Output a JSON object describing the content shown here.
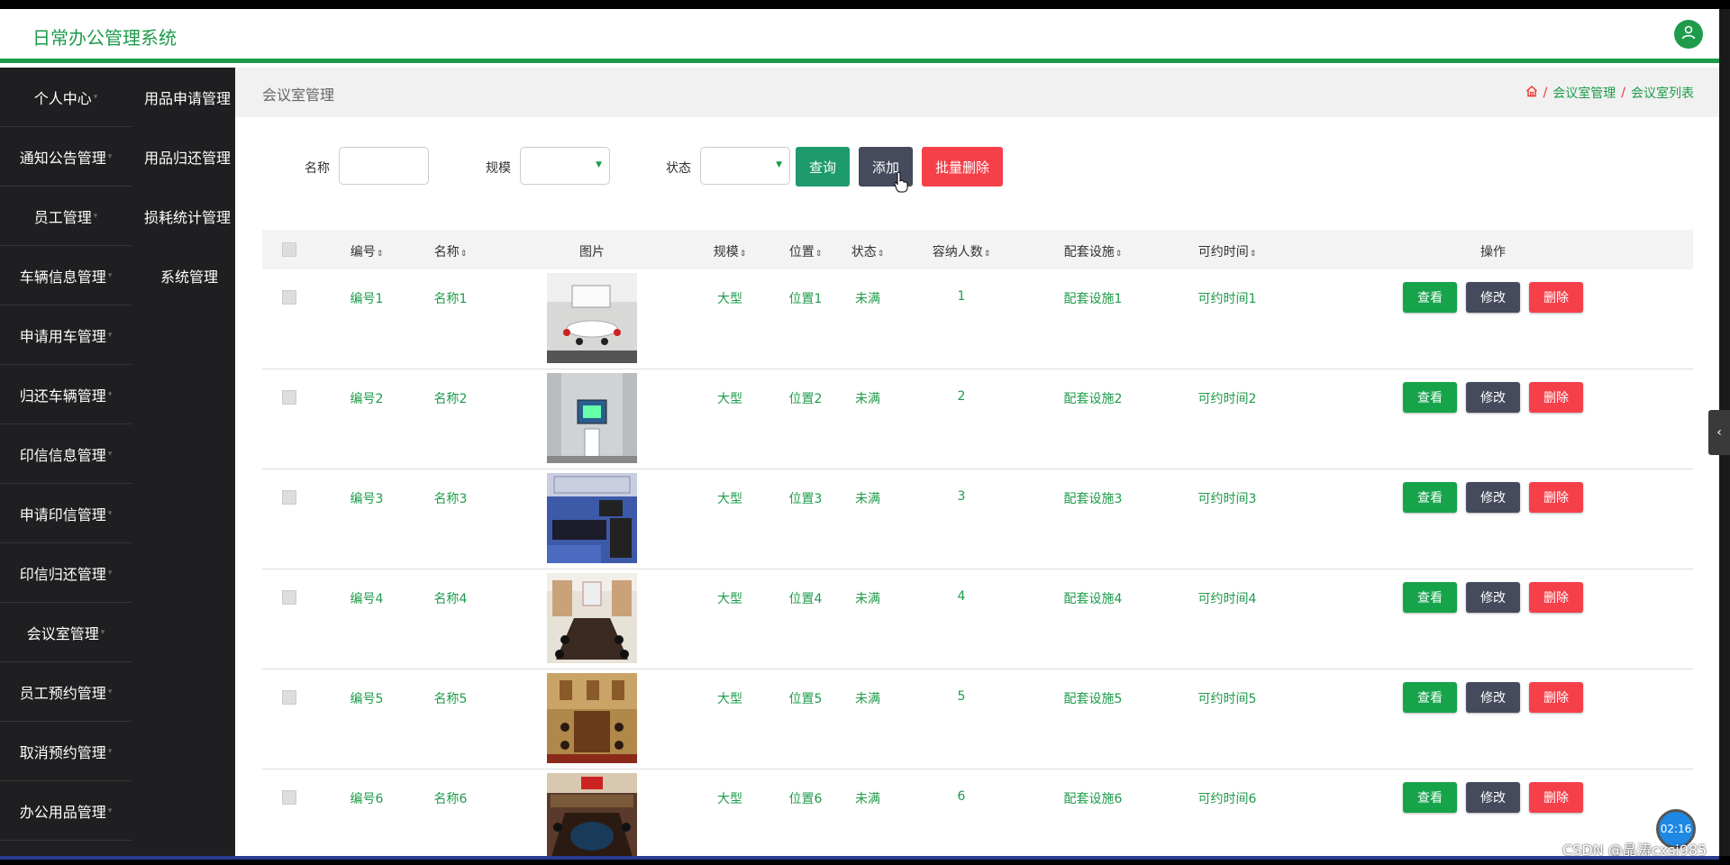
{
  "app": {
    "title": "日常办公管理系统"
  },
  "sidebar": {
    "col1": [
      "个人中心",
      "通知公告管理",
      "员工管理",
      "车辆信息管理",
      "申请用车管理",
      "归还车辆管理",
      "印信信息管理",
      "申请印信管理",
      "印信归还管理",
      "会议室管理",
      "员工预约管理",
      "取消预约管理",
      "办公用品管理"
    ],
    "col2": [
      "用品申请管理",
      "用品归还管理",
      "损耗统计管理",
      "系统管理"
    ]
  },
  "page": {
    "title": "会议室管理",
    "breadcrumb": [
      "会议室管理",
      "会议室列表"
    ]
  },
  "search": {
    "name_label": "名称",
    "scale_label": "规模",
    "status_label": "状态",
    "query_button": "查询",
    "add_button": "添加",
    "batch_delete_button": "批量删除"
  },
  "table": {
    "headers": [
      "编号",
      "名称",
      "图片",
      "规模",
      "位置",
      "状态",
      "容纳人数",
      "配套设施",
      "可约时间",
      "操作"
    ],
    "rows": [
      {
        "code": "编号1",
        "name": "名称1",
        "scale": "大型",
        "location": "位置1",
        "status": "未满",
        "capacity": "1",
        "facilities": "配套设施1",
        "time": "可约时间1"
      },
      {
        "code": "编号2",
        "name": "名称2",
        "scale": "大型",
        "location": "位置2",
        "status": "未满",
        "capacity": "2",
        "facilities": "配套设施2",
        "time": "可约时间2"
      },
      {
        "code": "编号3",
        "name": "名称3",
        "scale": "大型",
        "location": "位置3",
        "status": "未满",
        "capacity": "3",
        "facilities": "配套设施3",
        "time": "可约时间3"
      },
      {
        "code": "编号4",
        "name": "名称4",
        "scale": "大型",
        "location": "位置4",
        "status": "未满",
        "capacity": "4",
        "facilities": "配套设施4",
        "time": "可约时间4"
      },
      {
        "code": "编号5",
        "name": "名称5",
        "scale": "大型",
        "location": "位置5",
        "status": "未满",
        "capacity": "5",
        "facilities": "配套设施5",
        "time": "可约时间5"
      },
      {
        "code": "编号6",
        "name": "名称6",
        "scale": "大型",
        "location": "位置6",
        "status": "未满",
        "capacity": "6",
        "facilities": "配套设施6",
        "time": "可约时间6"
      }
    ],
    "actions": {
      "view": "查看",
      "edit": "修改",
      "delete": "删除"
    }
  },
  "overlay": {
    "timer": "02:16",
    "watermark": "CSDN @晶涛cxsj985"
  },
  "colors": {
    "accent": "#1e9b4b",
    "sidebar": "#1f1f21",
    "danger": "#f5404a",
    "dark_button": "#454a5c"
  },
  "icons": [
    "user-icon",
    "home-icon",
    "chevron-left-icon",
    "cursor-pointer-icon"
  ]
}
